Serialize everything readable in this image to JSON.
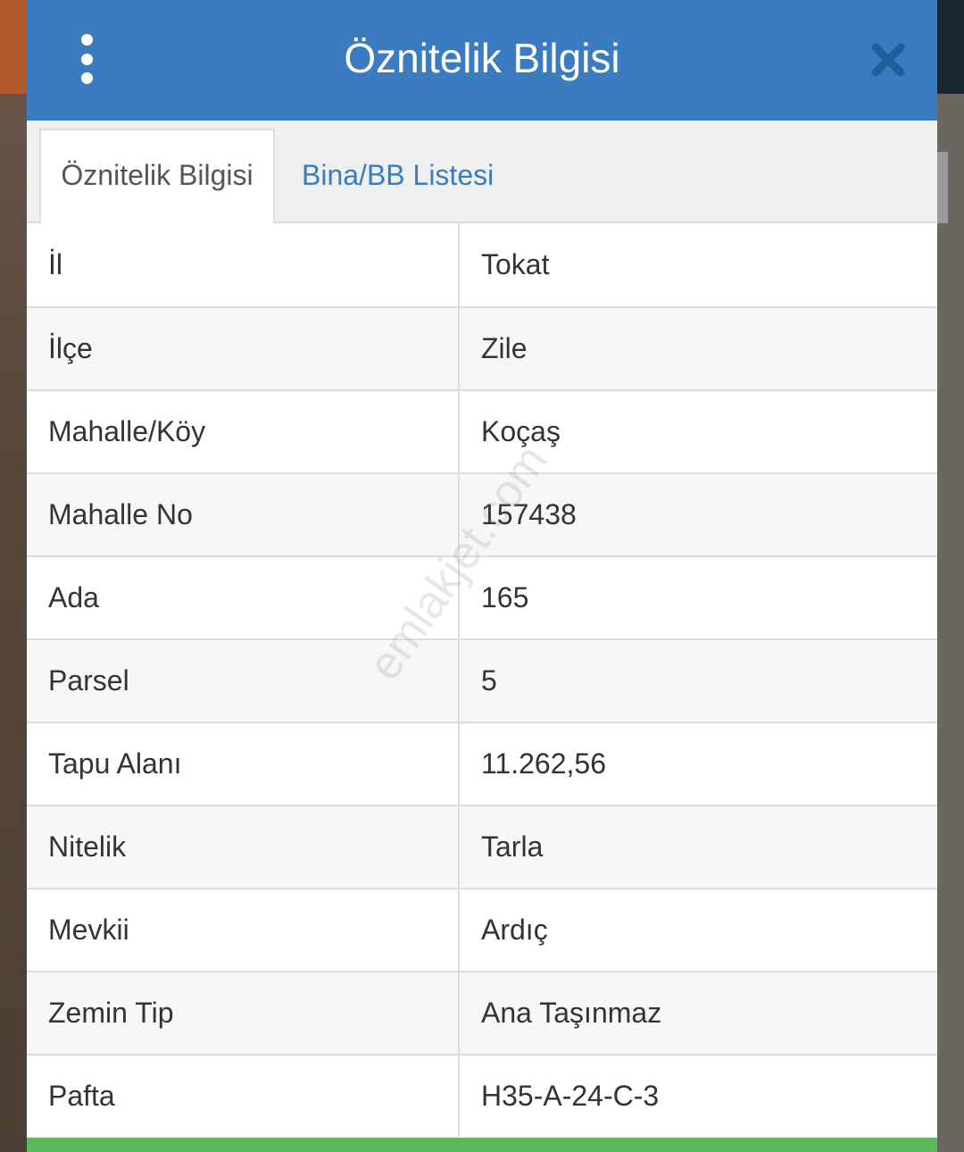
{
  "header": {
    "title": "Öznitelik Bilgisi"
  },
  "tabs": [
    {
      "label": "Öznitelik Bilgisi",
      "active": true
    },
    {
      "label": "Bina/BB Listesi",
      "active": false
    }
  ],
  "attributes": [
    {
      "key": "İl",
      "value": "Tokat"
    },
    {
      "key": "İlçe",
      "value": "Zile"
    },
    {
      "key": "Mahalle/Köy",
      "value": "Koçaş"
    },
    {
      "key": "Mahalle No",
      "value": "157438"
    },
    {
      "key": "Ada",
      "value": "165"
    },
    {
      "key": "Parsel",
      "value": "5"
    },
    {
      "key": "Tapu Alanı",
      "value": "11.262,56"
    },
    {
      "key": "Nitelik",
      "value": "Tarla"
    },
    {
      "key": "Mevkii",
      "value": "Ardıç"
    },
    {
      "key": "Zemin Tip",
      "value": "Ana Taşınmaz"
    },
    {
      "key": "Pafta",
      "value": "H35-A-24-C-3"
    }
  ],
  "watermark": "emlakjet.com",
  "colors": {
    "header": "#3b7bbf",
    "tab_link": "#3b7bbf",
    "footer_accent": "#5cb85c",
    "close_icon": "#1f5f99"
  },
  "icons": {
    "menu": "vertical-dots-icon",
    "close": "close-icon"
  }
}
